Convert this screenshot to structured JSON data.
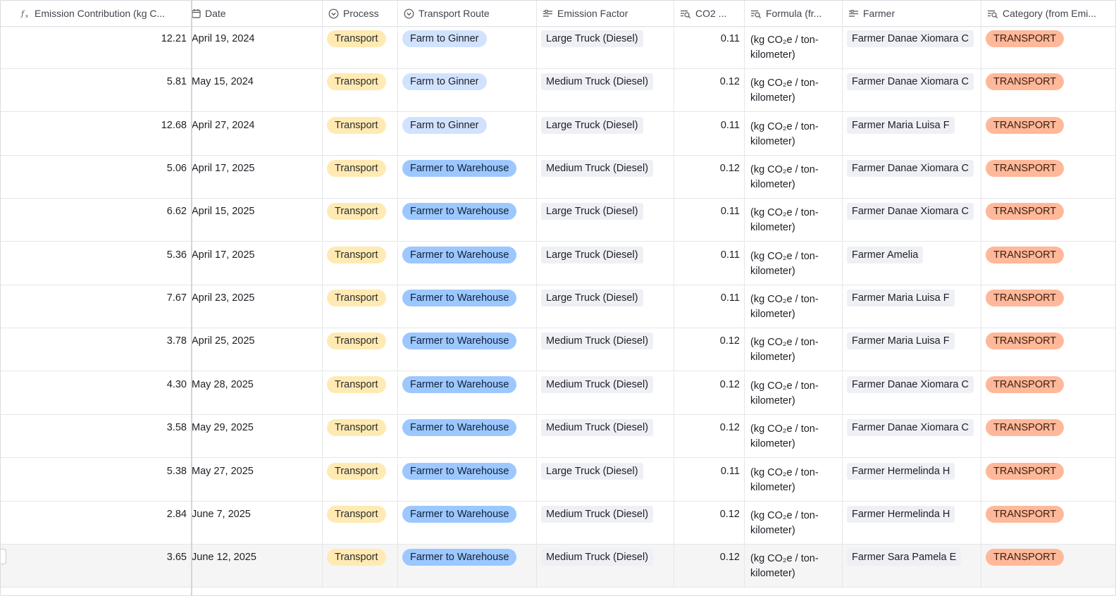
{
  "columns": [
    {
      "label": "Emission Contribution (kg C...",
      "icon": "formula-icon"
    },
    {
      "label": "Date",
      "icon": "calendar-icon"
    },
    {
      "label": "Process",
      "icon": "single-select-icon"
    },
    {
      "label": "Transport Route",
      "icon": "single-select-icon"
    },
    {
      "label": "Emission Factor",
      "icon": "link-icon"
    },
    {
      "label": "CO2 ...",
      "icon": "lookup-icon"
    },
    {
      "label": "Formula (fr...",
      "icon": "lookup-icon"
    },
    {
      "label": "Farmer",
      "icon": "link-icon"
    },
    {
      "label": "Category (from Emi...",
      "icon": "lookup-icon"
    }
  ],
  "rows": [
    {
      "emission": "12.21",
      "date": "April 19, 2024",
      "process": "Transport",
      "route": "Farm to Ginner",
      "factor": "Large Truck (Diesel)",
      "co2": "0.11",
      "formula": "(kg CO₂e / ton-kilometer)",
      "farmer": "Farmer Danae Xiomara C",
      "category": "TRANSPORT"
    },
    {
      "emission": "5.81",
      "date": "May 15, 2024",
      "process": "Transport",
      "route": "Farm to Ginner",
      "factor": "Medium Truck (Diesel)",
      "co2": "0.12",
      "formula": "(kg CO₂e / ton-kilometer)",
      "farmer": "Farmer Danae Xiomara C",
      "category": "TRANSPORT"
    },
    {
      "emission": "12.68",
      "date": "April 27, 2024",
      "process": "Transport",
      "route": "Farm to Ginner",
      "factor": "Large Truck (Diesel)",
      "co2": "0.11",
      "formula": "(kg CO₂e / ton-kilometer)",
      "farmer": "Farmer Maria Luisa F",
      "category": "TRANSPORT"
    },
    {
      "emission": "5.06",
      "date": "April 17, 2025",
      "process": "Transport",
      "route": "Farmer to Warehouse",
      "factor": "Medium Truck (Diesel)",
      "co2": "0.12",
      "formula": "(kg CO₂e / ton-kilometer)",
      "farmer": "Farmer Danae Xiomara C",
      "category": "TRANSPORT"
    },
    {
      "emission": "6.62",
      "date": "April 15, 2025",
      "process": "Transport",
      "route": "Farmer to Warehouse",
      "factor": "Large Truck (Diesel)",
      "co2": "0.11",
      "formula": "(kg CO₂e / ton-kilometer)",
      "farmer": "Farmer Danae Xiomara C",
      "category": "TRANSPORT"
    },
    {
      "emission": "5.36",
      "date": "April 17, 2025",
      "process": "Transport",
      "route": "Farmer to Warehouse",
      "factor": "Large Truck (Diesel)",
      "co2": "0.11",
      "formula": "(kg CO₂e / ton-kilometer)",
      "farmer": "Farmer Amelia",
      "category": "TRANSPORT"
    },
    {
      "emission": "7.67",
      "date": "April 23, 2025",
      "process": "Transport",
      "route": "Farmer to Warehouse",
      "factor": "Large Truck (Diesel)",
      "co2": "0.11",
      "formula": "(kg CO₂e / ton-kilometer)",
      "farmer": "Farmer Maria Luisa F",
      "category": "TRANSPORT"
    },
    {
      "emission": "3.78",
      "date": "April 25, 2025",
      "process": "Transport",
      "route": "Farmer to Warehouse",
      "factor": "Medium Truck (Diesel)",
      "co2": "0.12",
      "formula": "(kg CO₂e / ton-kilometer)",
      "farmer": "Farmer Maria Luisa F",
      "category": "TRANSPORT"
    },
    {
      "emission": "4.30",
      "date": "May 28, 2025",
      "process": "Transport",
      "route": "Farmer to Warehouse",
      "factor": "Medium Truck (Diesel)",
      "co2": "0.12",
      "formula": "(kg CO₂e / ton-kilometer)",
      "farmer": "Farmer Danae Xiomara C",
      "category": "TRANSPORT"
    },
    {
      "emission": "3.58",
      "date": "May 29, 2025",
      "process": "Transport",
      "route": "Farmer to Warehouse",
      "factor": "Medium Truck (Diesel)",
      "co2": "0.12",
      "formula": "(kg CO₂e / ton-kilometer)",
      "farmer": "Farmer Danae Xiomara C",
      "category": "TRANSPORT"
    },
    {
      "emission": "5.38",
      "date": "May 27, 2025",
      "process": "Transport",
      "route": "Farmer to Warehouse",
      "factor": "Large Truck (Diesel)",
      "co2": "0.11",
      "formula": "(kg CO₂e / ton-kilometer)",
      "farmer": "Farmer Hermelinda H",
      "category": "TRANSPORT"
    },
    {
      "emission": "2.84",
      "date": "June 7, 2025",
      "process": "Transport",
      "route": "Farmer to Warehouse",
      "factor": "Medium Truck (Diesel)",
      "co2": "0.12",
      "formula": "(kg CO₂e / ton-kilometer)",
      "farmer": "Farmer Hermelinda H",
      "category": "TRANSPORT"
    },
    {
      "emission": "3.65",
      "date": "June 12, 2025",
      "process": "Transport",
      "route": "Farmer to Warehouse",
      "factor": "Medium Truck (Diesel)",
      "co2": "0.12",
      "formula": "(kg CO₂e / ton-kilometer)",
      "farmer": "Farmer Sara Pamela E",
      "category": "TRANSPORT"
    }
  ],
  "colors": {
    "process_pill": "#ffeab3",
    "route_ginner_pill": "#d1e2ff",
    "route_warehouse_pill": "#9cc7ff",
    "category_pill": "#ffb899",
    "linked_tag": "#eef0f5"
  }
}
